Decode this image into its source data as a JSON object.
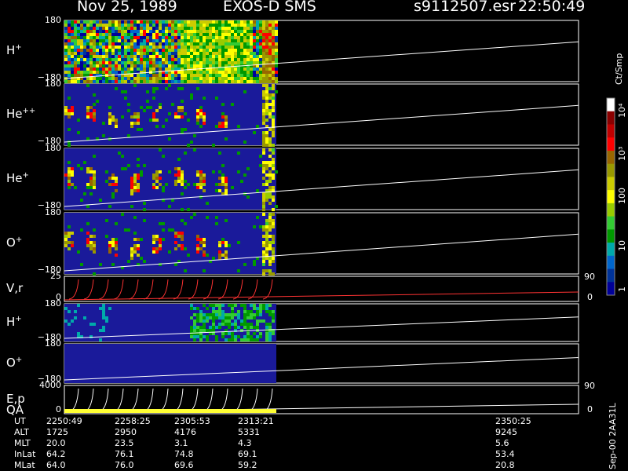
{
  "header": {
    "date": "Nov 25, 1989",
    "instrument": "EXOS-D SMS",
    "file": "s9112507.esr",
    "time": "22:50:49"
  },
  "panels": [
    {
      "label_main": "H",
      "label_sup": "+",
      "ytop": "180",
      "ybot": "−180",
      "kind": "spectro",
      "fill": "rich"
    },
    {
      "label_main": "He",
      "label_sup": "++",
      "ytop": "180",
      "ybot": "−180",
      "kind": "spectro",
      "fill": "sparse"
    },
    {
      "label_main": "He",
      "label_sup": "+",
      "ytop": "180",
      "ybot": "−180",
      "kind": "spectro",
      "fill": "medium"
    },
    {
      "label_main": "O",
      "label_sup": "+",
      "ytop": "180",
      "ybot": "−180",
      "kind": "spectro",
      "fill": "medium"
    },
    {
      "label_main": "V,r",
      "label_sup": "",
      "ytop": "25",
      "ybot": "0",
      "kind": "line",
      "rtop": "90",
      "rbot": "0"
    },
    {
      "label_main": "H",
      "label_sup": "+",
      "ytop": "180",
      "ybot": "−180",
      "kind": "spectro",
      "fill": "vertical"
    },
    {
      "label_main": "O",
      "label_sup": "+",
      "ytop": "180",
      "ybot": "−180",
      "kind": "spectro",
      "fill": "empty"
    },
    {
      "label_main": "E,p",
      "label_sup": "",
      "label2": "QA",
      "ytop": "4000",
      "ybot": "0",
      "kind": "line2",
      "rtop": "90",
      "rbot": "0"
    }
  ],
  "colorbar": {
    "unit": "Ct/Smp",
    "ticks": [
      "10⁴",
      "10³",
      "100",
      "10",
      "1"
    ],
    "colors": [
      "#ffffff",
      "#8b0000",
      "#c00000",
      "#ff0000",
      "#996600",
      "#999900",
      "#cccc00",
      "#ffff00",
      "#99cc00",
      "#33cc33",
      "#009900",
      "#00aaaa",
      "#0066cc",
      "#003399",
      "#000099"
    ]
  },
  "table": {
    "rows": [
      {
        "label": "UT",
        "values": [
          "2250:49",
          "2258:25",
          "2305:53",
          "2313:21",
          "2350:25"
        ]
      },
      {
        "label": "ALT",
        "values": [
          "1725",
          "2950",
          "4176",
          "5331",
          "9245"
        ]
      },
      {
        "label": "MLT",
        "values": [
          "20.0",
          "23.5",
          "3.1",
          "4.3",
          "5.6"
        ]
      },
      {
        "label": "InLat",
        "values": [
          "64.2",
          "76.1",
          "74.8",
          "69.1",
          "53.4"
        ]
      },
      {
        "label": "MLat",
        "values": [
          "64.0",
          "76.0",
          "69.6",
          "59.2",
          "20.8"
        ]
      }
    ]
  },
  "footer": "Sep-00 2AA31L"
}
